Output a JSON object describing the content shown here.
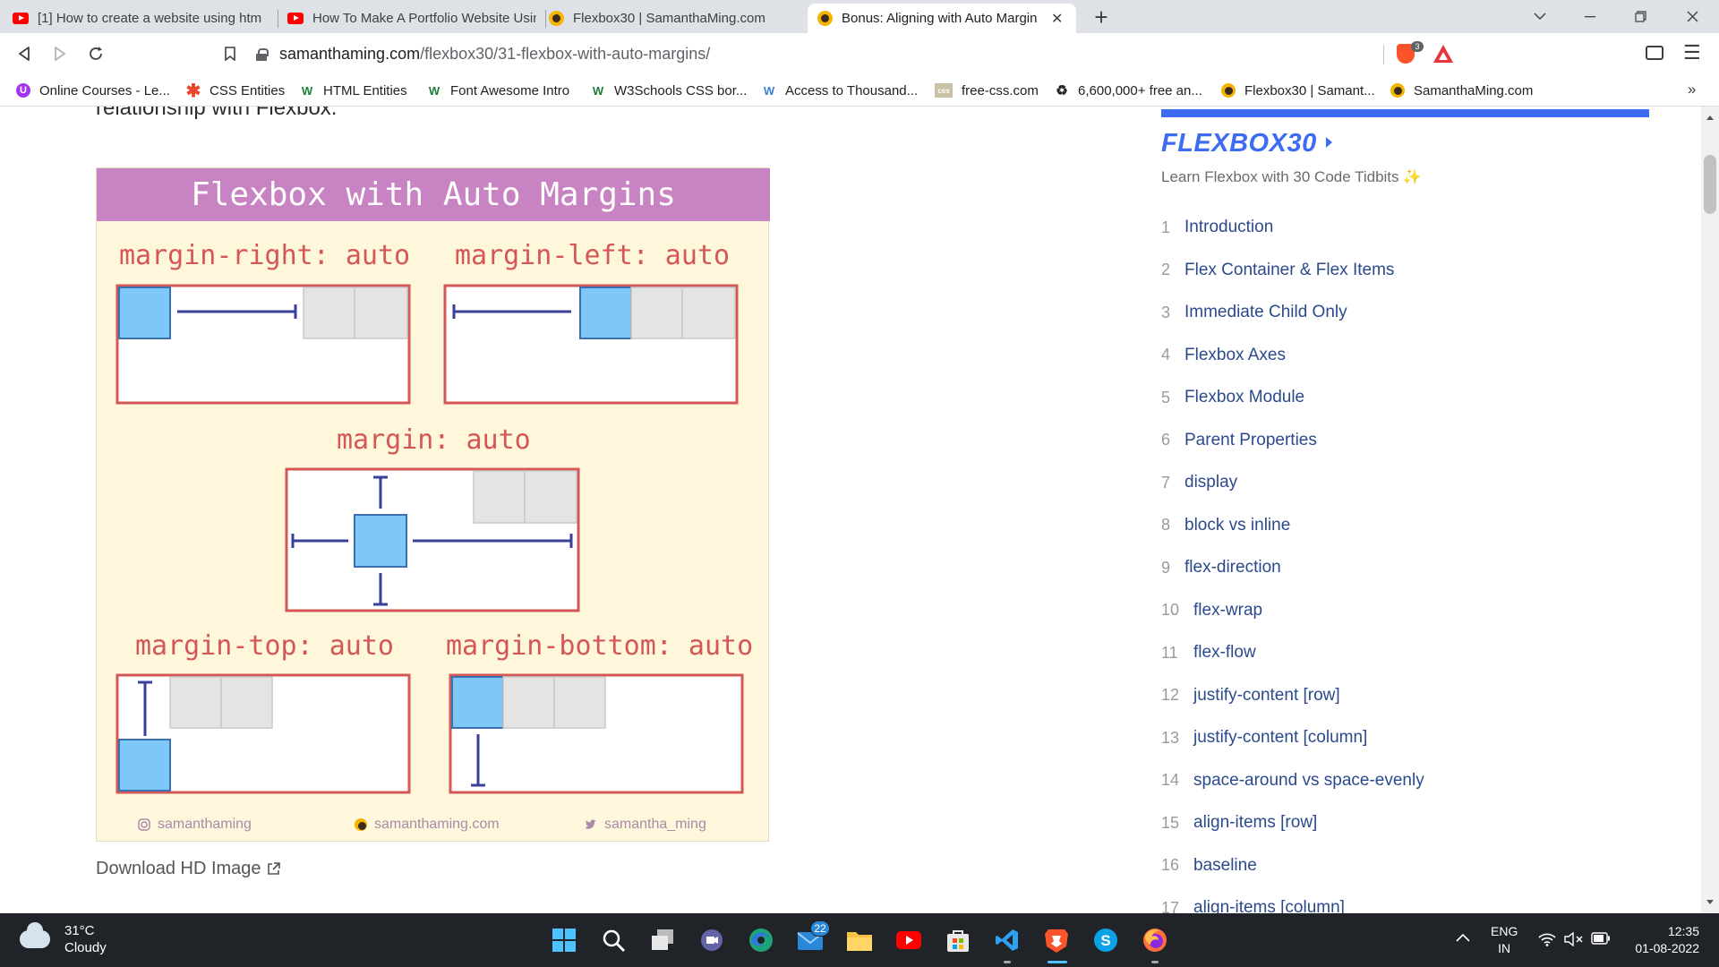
{
  "browser": {
    "tabs": [
      {
        "label": "[1] How to create a website using htm",
        "favicon": "youtube-icon",
        "active": false
      },
      {
        "label": "How To Make A Portfolio Website Usin",
        "favicon": "youtube-icon",
        "active": false
      },
      {
        "label": "Flexbox30 | SamanthaMing.com",
        "favicon": "samanthaming-icon",
        "active": false
      },
      {
        "label": "Bonus: Aligning with Auto Margin",
        "favicon": "samanthaming-icon",
        "active": true
      }
    ],
    "new_tab_label": "+",
    "url_host": "samanthaming.com",
    "url_path": "/flexbox30/31-flexbox-with-auto-margins/",
    "shield_count": "3",
    "bookmarks": [
      {
        "label": "Online Courses - Le...",
        "icon": "udemy-icon"
      },
      {
        "label": "CSS Entities",
        "icon": "asterisk-icon"
      },
      {
        "label": "HTML Entities",
        "icon": "w3-icon"
      },
      {
        "label": "Font Awesome Intro",
        "icon": "w3-icon"
      },
      {
        "label": "W3Schools CSS bor...",
        "icon": "w3-icon"
      },
      {
        "label": "Access to Thousand...",
        "icon": "w-icon"
      },
      {
        "label": "free-css.com",
        "icon": "css-icon"
      },
      {
        "label": "6,600,000+ free an...",
        "icon": "recycle-icon"
      },
      {
        "label": "Flexbox30 | Samant...",
        "icon": "samanthaming-icon"
      },
      {
        "label": "SamanthaMing.com",
        "icon": "samanthaming-icon"
      }
    ],
    "bookmarks_more": "»"
  },
  "content": {
    "intro_text": "relationship with Flexbox.",
    "infographic": {
      "title": "Flexbox with Auto Margins",
      "labels": {
        "margin_right": "margin-right: auto",
        "margin_left": "margin-left: auto",
        "margin": "margin: auto",
        "margin_top": "margin-top: auto",
        "margin_bottom": "margin-bottom: auto"
      },
      "footer": {
        "instagram": "samanthaming",
        "website": "samanthaming.com",
        "twitter": "samantha_ming"
      },
      "colors": {
        "title_bg": "#c883c2",
        "background": "#fff7dc",
        "frame": "#d45756",
        "box_highlight": "#7ec8f8",
        "box_grey": "#e4e4e4",
        "line": "#3a3f9a"
      }
    },
    "download_label": "Download HD Image"
  },
  "sidebar": {
    "title": "FLEXBOX30",
    "subtitle": "Learn Flexbox with 30 Code Tidbits",
    "sparkle": "✨",
    "accent": "#3d6cf2",
    "items": [
      {
        "num": "1",
        "label": "Introduction"
      },
      {
        "num": "2",
        "label": "Flex Container & Flex Items"
      },
      {
        "num": "3",
        "label": "Immediate Child Only"
      },
      {
        "num": "4",
        "label": "Flexbox Axes"
      },
      {
        "num": "5",
        "label": "Flexbox Module"
      },
      {
        "num": "6",
        "label": "Parent Properties"
      },
      {
        "num": "7",
        "label": "display"
      },
      {
        "num": "8",
        "label": "block vs inline"
      },
      {
        "num": "9",
        "label": "flex-direction"
      },
      {
        "num": "10",
        "label": "flex-wrap"
      },
      {
        "num": "11",
        "label": "flex-flow"
      },
      {
        "num": "12",
        "label": "justify-content [row]"
      },
      {
        "num": "13",
        "label": "justify-content [column]"
      },
      {
        "num": "14",
        "label": "space-around vs space-evenly"
      },
      {
        "num": "15",
        "label": "align-items [row]"
      },
      {
        "num": "16",
        "label": "baseline"
      },
      {
        "num": "17",
        "label": "align-items [column]"
      }
    ]
  },
  "taskbar": {
    "weather_temp": "31°C",
    "weather_desc": "Cloudy",
    "mail_badge": "22",
    "lang_top": "ENG",
    "lang_bottom": "IN",
    "time": "12:35",
    "date": "01-08-2022"
  }
}
